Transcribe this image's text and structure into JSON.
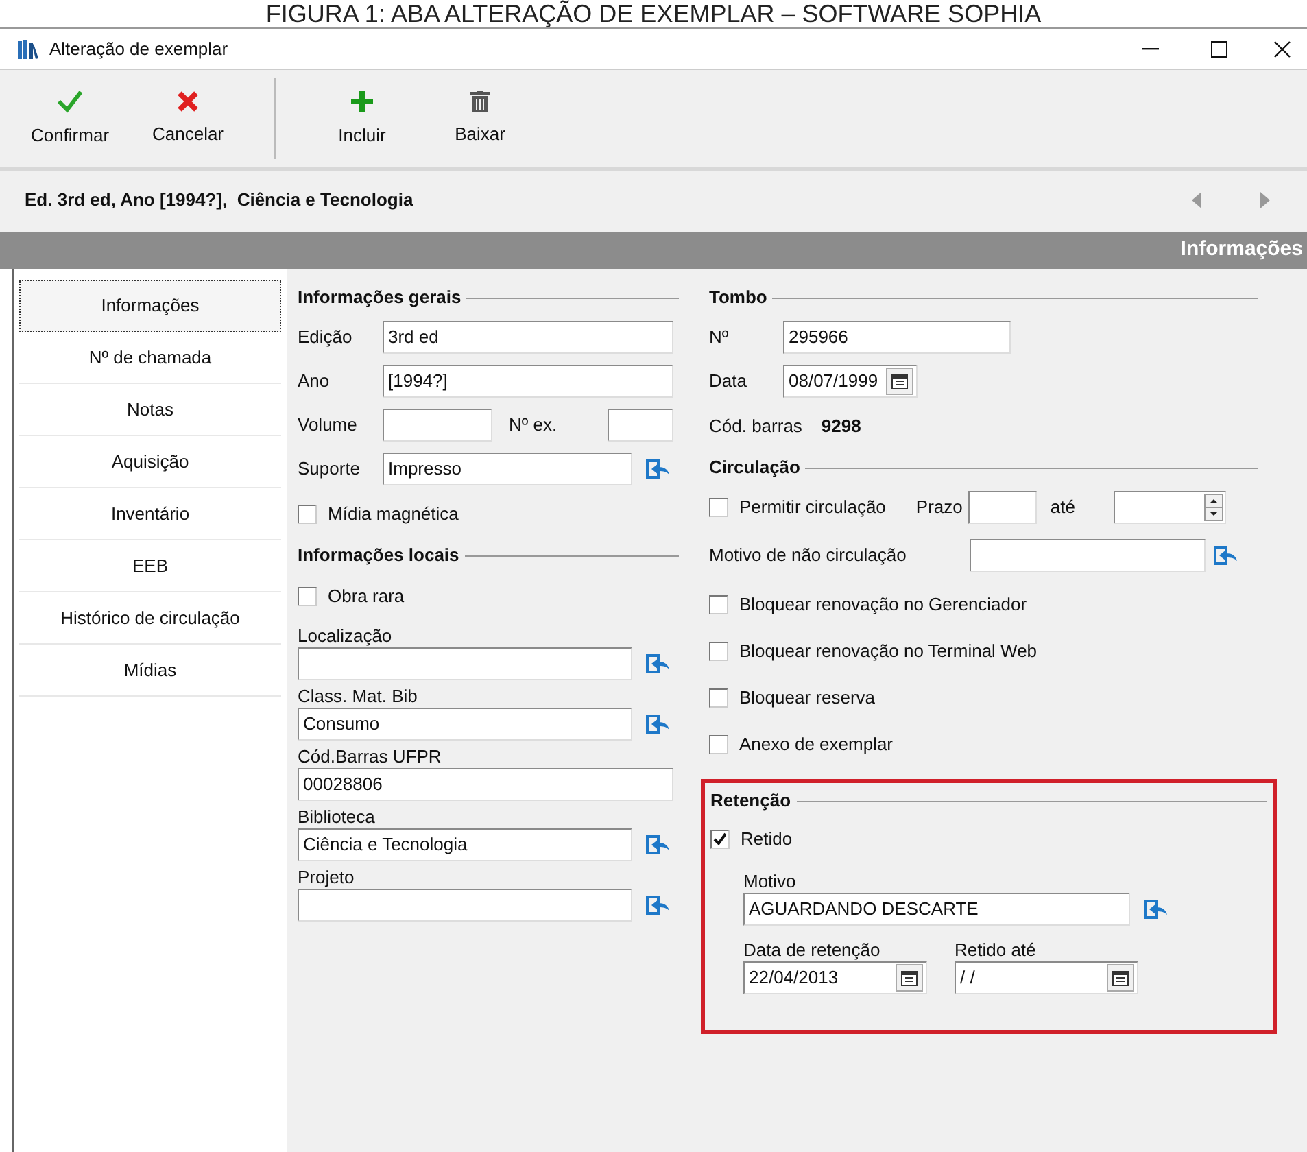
{
  "caption": "FIGURA 1: ABA ALTERAÇÃO DE EXEMPLAR – SOFTWARE SOPHIA",
  "window": {
    "title": "Alteração de exemplar"
  },
  "toolbar": [
    {
      "label": "Confirmar",
      "kind": "confirm"
    },
    {
      "label": "Cancelar",
      "kind": "cancel"
    },
    {
      "label": "Incluir",
      "kind": "add"
    },
    {
      "label": "Baixar",
      "kind": "delete"
    }
  ],
  "record_summary": "Ed. 3rd ed, Ano [1994?],  Ciência e Tecnologia",
  "section_header": "Informações",
  "sidebar": {
    "items": [
      {
        "label": "Informações",
        "selected": true
      },
      {
        "label": "Nº de chamada",
        "selected": false
      },
      {
        "label": "Notas",
        "selected": false
      },
      {
        "label": "Aquisição",
        "selected": false
      },
      {
        "label": "Inventário",
        "selected": false
      },
      {
        "label": "EEB",
        "selected": false
      },
      {
        "label": "Histórico de circulação",
        "selected": false
      },
      {
        "label": "Mídias",
        "selected": false
      }
    ]
  },
  "left_column": [
    {
      "kind": "heading",
      "label": "Informações gerais"
    },
    {
      "kind": "inline",
      "label": "Edição",
      "value": "3rd ed",
      "lookup": false
    },
    {
      "kind": "inline",
      "label": "Ano",
      "value": "[1994?]",
      "lookup": false
    },
    {
      "kind": "pair",
      "label": "Volume",
      "label_2": "Nº ex."
    },
    {
      "kind": "inline",
      "label": "Suporte",
      "value": "Impresso",
      "lookup": true
    },
    {
      "kind": "checkbox",
      "label": "Mídia magnética",
      "checked": false
    },
    {
      "kind": "heading",
      "label": "Informações locais"
    },
    {
      "kind": "checkbox",
      "label": "Obra rara",
      "checked": false
    },
    {
      "kind": "stacked",
      "label": "Localização",
      "lookup": true
    },
    {
      "kind": "stacked",
      "label": "Class. Mat. Bib",
      "value": "Consumo",
      "lookup": true
    },
    {
      "kind": "stacked",
      "label": "Cód.Barras UFPR",
      "value": "00028806",
      "lookup": false
    },
    {
      "kind": "stacked",
      "label": "Biblioteca",
      "value": "Ciência e Tecnologia",
      "lookup": true
    },
    {
      "kind": "stacked",
      "label": "Projeto",
      "lookup": true
    }
  ],
  "right_column": [
    {
      "kind": "heading",
      "label": "Tombo"
    },
    {
      "kind": "inline",
      "label": "Nº",
      "value": "295966",
      "lookup": false
    },
    {
      "kind": "date",
      "label": "Data",
      "value": "08/07/1999"
    },
    {
      "kind": "readout",
      "label": "Cód. barras",
      "value": "9298"
    },
    {
      "kind": "heading",
      "label": "Circulação"
    },
    {
      "kind": "circulation",
      "label": "Permitir circulação",
      "checked": false,
      "label_2": "Prazo",
      "label_3": "até"
    },
    {
      "kind": "wide",
      "label": "Motivo de não circulação",
      "lookup": true
    },
    {
      "kind": "checkbox",
      "label": "Bloquear renovação no Gerenciador",
      "checked": false
    },
    {
      "kind": "checkbox",
      "label": "Bloquear renovação no Terminal Web",
      "checked": false
    },
    {
      "kind": "checkbox",
      "label": "Bloquear reserva",
      "checked": false
    },
    {
      "kind": "checkbox",
      "label": "Anexo de exemplar",
      "checked": false
    }
  ],
  "retention": {
    "title": "Retenção",
    "highlighted": true,
    "retido": {
      "label": "Retido",
      "checked": true
    },
    "motivo": {
      "label": "Motivo",
      "value": "AGUARDANDO DESCARTE",
      "lookup": true
    },
    "data_retencao": {
      "label": "Data de retenção",
      "value": "22/04/2013"
    },
    "retido_ate": {
      "label": "Retido até",
      "value": "/ /"
    }
  }
}
